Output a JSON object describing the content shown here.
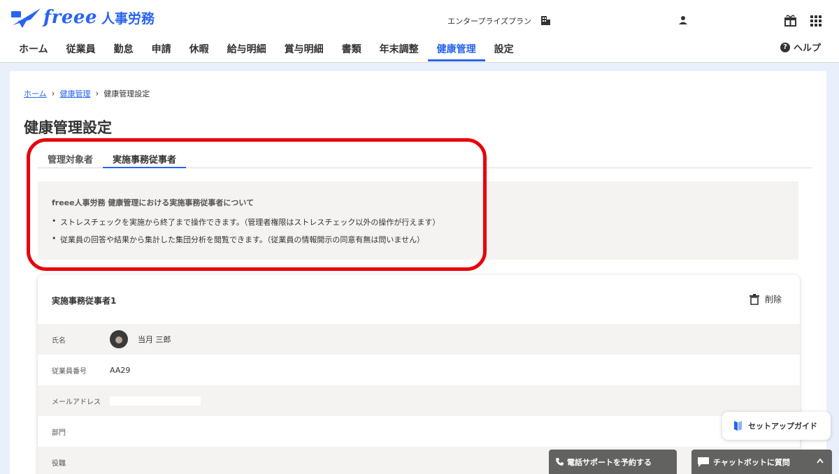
{
  "header": {
    "brand": "freee",
    "product": "人事労務",
    "plan": "エンタープライズプラン",
    "help_label": "ヘルプ",
    "icons": [
      "building-icon",
      "person-icon",
      "gift-icon",
      "app-grid-icon"
    ]
  },
  "nav": {
    "items": [
      {
        "label": "ホーム"
      },
      {
        "label": "従業員"
      },
      {
        "label": "勤怠"
      },
      {
        "label": "申請"
      },
      {
        "label": "休暇"
      },
      {
        "label": "給与明細"
      },
      {
        "label": "賞与明細"
      },
      {
        "label": "書類"
      },
      {
        "label": "年末調整"
      },
      {
        "label": "健康管理",
        "active": true
      },
      {
        "label": "設定"
      }
    ]
  },
  "breadcrumb": {
    "home": "ホーム",
    "health": "健康管理",
    "current": "健康管理設定"
  },
  "page": {
    "title": "健康管理設定"
  },
  "tabs": [
    {
      "label": "管理対象者"
    },
    {
      "label": "実施事務従事者",
      "active": true
    }
  ],
  "info": {
    "heading": "freee人事労務 健康管理における実施事務従事者について",
    "bullets": [
      "ストレスチェックを実施から終了まで操作できます。（管理者権限はストレスチェック以外の操作が行えます）",
      "従業員の回答や結果から集計した集団分析を閲覧できます。（従業員の情報開示の同意有無は問いません）"
    ]
  },
  "card": {
    "title": "実施事務従事者1",
    "delete_label": "削除",
    "fields": {
      "name_label": "氏名",
      "name_value": "当月 三郎",
      "employee_no_label": "従業員番号",
      "employee_no_value": "AA29",
      "email_label": "メールアドレス",
      "department_label": "部門",
      "position_label": "役職"
    }
  },
  "floating": {
    "setup_guide": "セットアップガイド",
    "phone_support": "電話サポートを予約する",
    "chatbot": "チャットボットに質問"
  },
  "colors": {
    "accent": "#2864f0",
    "highlight": "#e8000b",
    "footer_button": "#626260"
  }
}
